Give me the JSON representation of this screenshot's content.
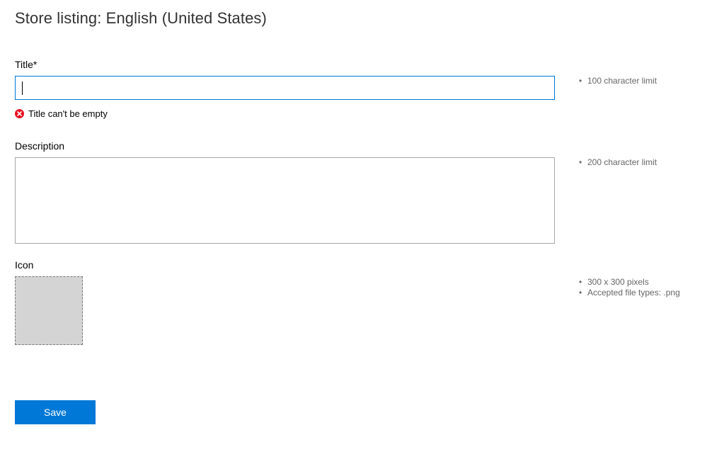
{
  "page": {
    "title": "Store listing: English (United States)"
  },
  "form": {
    "title_field": {
      "label": "Title*",
      "value": "",
      "error": "Title can't be empty",
      "hints": [
        "100 character limit"
      ]
    },
    "description_field": {
      "label": "Description",
      "value": "",
      "hints": [
        "200 character limit"
      ]
    },
    "icon_field": {
      "label": "Icon",
      "hints": [
        "300 x 300 pixels",
        "Accepted file types: .png"
      ]
    },
    "save_label": "Save"
  },
  "colors": {
    "accent": "#0078d7",
    "error": "#e81123",
    "icon_placeholder": "#d4d4d4",
    "hint_text": "#666666"
  }
}
